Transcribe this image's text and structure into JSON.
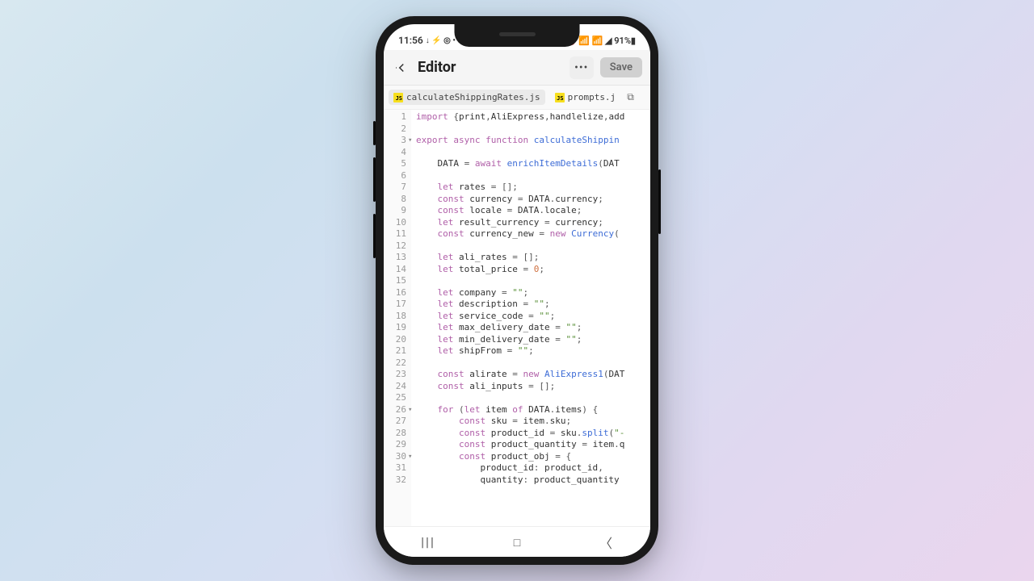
{
  "status": {
    "time": "11:56",
    "leftIcons": "↓ ⚡ ◎ •",
    "rightIcons": "🔕 📶 📶 ◢ 91%▮"
  },
  "header": {
    "title": "Editor",
    "more": "•••",
    "save": "Save"
  },
  "tabs": {
    "jsBadge": "JS",
    "tab1": "calculateShippingRates.js",
    "tab2": "prompts.j",
    "copyIcon": "⧉"
  },
  "code": {
    "lines": [
      {
        "n": 1,
        "html": "<span class='kw-import'>import</span> <span class='pun'>{</span>print<span class='pun'>,</span>AliExpress<span class='pun'>,</span>handlelize<span class='pun'>,</span>add"
      },
      {
        "n": 2,
        "html": ""
      },
      {
        "n": 3,
        "fold": true,
        "html": "<span class='kw-export'>export</span> <span class='kw-async'>async</span> <span class='kw-func'>function</span> <span class='fn-name'>calculateShippin</span>"
      },
      {
        "n": 4,
        "html": ""
      },
      {
        "n": 5,
        "html": "    <span class='var-upper'>DATA</span> <span class='pun'>=</span> <span class='kw-await'>await</span> <span class='fn-call'>enrichItemDetails</span><span class='pun'>(</span>DAT"
      },
      {
        "n": 6,
        "html": ""
      },
      {
        "n": 7,
        "html": "    <span class='kw-let'>let</span> rates <span class='pun'>=</span> <span class='pun'>[];</span>"
      },
      {
        "n": 8,
        "html": "    <span class='kw-const'>const</span> currency <span class='pun'>=</span> DATA<span class='pun'>.</span>currency<span class='pun'>;</span>"
      },
      {
        "n": 9,
        "html": "    <span class='kw-const'>const</span> locale <span class='pun'>=</span> DATA<span class='pun'>.</span>locale<span class='pun'>;</span>"
      },
      {
        "n": 10,
        "html": "    <span class='kw-let'>let</span> result_currency <span class='pun'>=</span> currency<span class='pun'>;</span>"
      },
      {
        "n": 11,
        "html": "    <span class='kw-const'>const</span> currency_new <span class='pun'>=</span> <span class='kw-new'>new</span> <span class='fn-call'>Currency</span><span class='pun'>(</span>"
      },
      {
        "n": 12,
        "html": ""
      },
      {
        "n": 13,
        "html": "    <span class='kw-let'>let</span> ali_rates <span class='pun'>=</span> <span class='pun'>[];</span>"
      },
      {
        "n": 14,
        "html": "    <span class='kw-let'>let</span> total_price <span class='pun'>=</span> <span class='num'>0</span><span class='pun'>;</span>"
      },
      {
        "n": 15,
        "html": ""
      },
      {
        "n": 16,
        "html": "    <span class='kw-let'>let</span> company <span class='pun'>=</span> <span class='str'>\"\"</span><span class='pun'>;</span>"
      },
      {
        "n": 17,
        "html": "    <span class='kw-let'>let</span> description <span class='pun'>=</span> <span class='str'>\"\"</span><span class='pun'>;</span>"
      },
      {
        "n": 18,
        "html": "    <span class='kw-let'>let</span> service_code <span class='pun'>=</span> <span class='str'>\"\"</span><span class='pun'>;</span>"
      },
      {
        "n": 19,
        "html": "    <span class='kw-let'>let</span> max_delivery_date <span class='pun'>=</span> <span class='str'>\"\"</span><span class='pun'>;</span>"
      },
      {
        "n": 20,
        "html": "    <span class='kw-let'>let</span> min_delivery_date <span class='pun'>=</span> <span class='str'>\"\"</span><span class='pun'>;</span>"
      },
      {
        "n": 21,
        "html": "    <span class='kw-let'>let</span> shipFrom <span class='pun'>=</span> <span class='str'>\"\"</span><span class='pun'>;</span>"
      },
      {
        "n": 22,
        "html": ""
      },
      {
        "n": 23,
        "html": "    <span class='kw-const'>const</span> alirate <span class='pun'>=</span> <span class='kw-new'>new</span> <span class='fn-call'>AliExpress1</span><span class='pun'>(</span>DAT"
      },
      {
        "n": 24,
        "html": "    <span class='kw-const'>const</span> ali_inputs <span class='pun'>=</span> <span class='pun'>[];</span>"
      },
      {
        "n": 25,
        "html": ""
      },
      {
        "n": 26,
        "fold": true,
        "html": "    <span class='kw-for'>for</span> <span class='pun'>(</span><span class='kw-let'>let</span> item <span class='kw-of'>of</span> DATA<span class='pun'>.</span>items<span class='pun'>)</span> <span class='pun'>{</span>"
      },
      {
        "n": 27,
        "html": "        <span class='kw-const'>const</span> sku <span class='pun'>=</span> item<span class='pun'>.</span>sku<span class='pun'>;</span>"
      },
      {
        "n": 28,
        "html": "        <span class='kw-const'>const</span> product_id <span class='pun'>=</span> sku<span class='pun'>.</span><span class='fn-call'>split</span><span class='pun'>(</span><span class='str'>\"-</span>"
      },
      {
        "n": 29,
        "html": "        <span class='kw-const'>const</span> product_quantity <span class='pun'>=</span> item<span class='pun'>.</span>q"
      },
      {
        "n": 30,
        "fold": true,
        "html": "        <span class='kw-const'>const</span> product_obj <span class='pun'>=</span> <span class='pun'>{</span>"
      },
      {
        "n": 31,
        "html": "            product_id<span class='pun'>:</span> product_id<span class='pun'>,</span>"
      },
      {
        "n": 32,
        "html": "            quantity<span class='pun'>:</span> product_quantity"
      }
    ]
  },
  "nav": {
    "recents": "|||",
    "home": "□",
    "back": "〈"
  }
}
